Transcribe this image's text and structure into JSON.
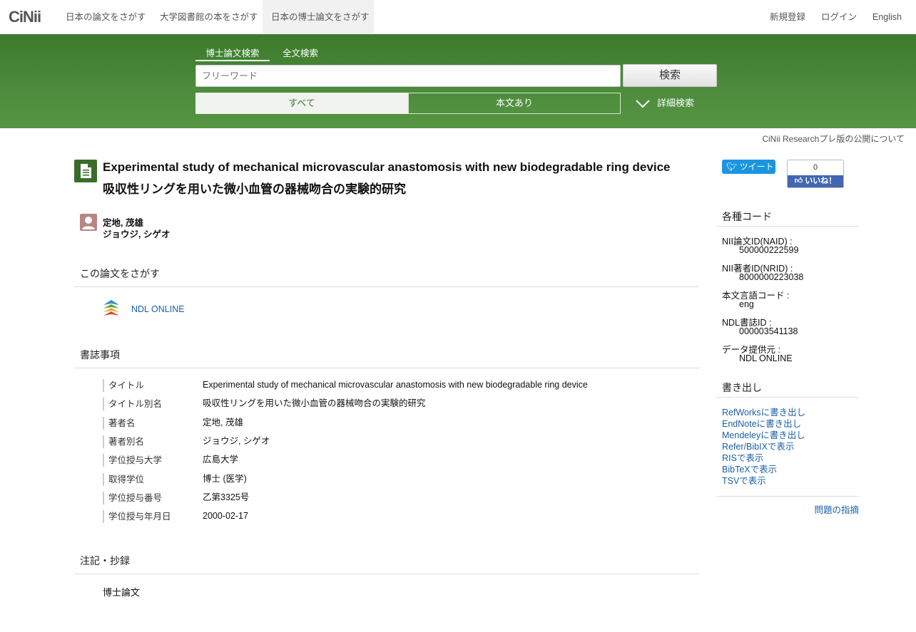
{
  "nav": {
    "logo": "CiNii",
    "links": [
      "日本の論文をさがす",
      "大学図書館の本をさがす",
      "日本の博士論文をさがす"
    ],
    "right": [
      "新規登録",
      "ログイン",
      "English"
    ]
  },
  "search": {
    "tabs": [
      "博士論文検索",
      "全文検索"
    ],
    "placeholder": "フリーワード",
    "button": "検索",
    "filters": [
      "すべて",
      "本文あり"
    ],
    "advanced": "詳細検索"
  },
  "notice": "CiNii Researchプレ版の公開について",
  "article": {
    "title_en": "Experimental study of mechanical microvascular anastomosis with new biodegradable ring device",
    "title_ja": "吸収性リングを用いた微小血管の器械吻合の実験的研究",
    "author": "定地, 茂雄",
    "author_kana": "ジョウジ, シゲオ"
  },
  "find": {
    "heading": "この論文をさがす",
    "link": "NDL ONLINE"
  },
  "biblio": {
    "heading": "書誌事項",
    "rows": [
      {
        "label": "タイトル",
        "value": "Experimental study of mechanical microvascular anastomosis with new biodegradable ring device"
      },
      {
        "label": "タイトル別名",
        "value": "吸収性リングを用いた微小血管の器械吻合の実験的研究"
      },
      {
        "label": "著者名",
        "value": "定地, 茂雄"
      },
      {
        "label": "著者別名",
        "value": "ジョウジ, シゲオ"
      },
      {
        "label": "学位授与大学",
        "value": "広島大学"
      },
      {
        "label": "取得学位",
        "value": "博士 (医学)"
      },
      {
        "label": "学位授与番号",
        "value": "乙第3325号"
      },
      {
        "label": "学位授与年月日",
        "value": "2000-02-17"
      }
    ]
  },
  "notes": {
    "heading": "注記・抄録",
    "text": "博士論文"
  },
  "social": {
    "tweet": "ツイート",
    "like_count": "0",
    "like": "いいね！"
  },
  "codes": {
    "heading": "各種コード",
    "items": [
      {
        "key": "NII論文ID(NAID) :",
        "value": "500000222599"
      },
      {
        "key": "NII著者ID(NRID) :",
        "value": "8000000223038"
      },
      {
        "key": "本文言語コード :",
        "value": "eng"
      },
      {
        "key": "NDL書誌ID :",
        "value": "000003541138"
      },
      {
        "key": "データ提供元 :",
        "value": "NDL ONLINE"
      }
    ]
  },
  "export": {
    "heading": "書き出し",
    "links": [
      "RefWorksに書き出し",
      "EndNoteに書き出し",
      "Mendeleyに書き出し",
      "Refer/BibIXで表示",
      "RISで表示",
      "BibTeXで表示",
      "TSVで表示"
    ]
  },
  "report": "問題の指摘",
  "colors": {
    "band": "#4d8c3c",
    "link": "#1a5fa8"
  }
}
